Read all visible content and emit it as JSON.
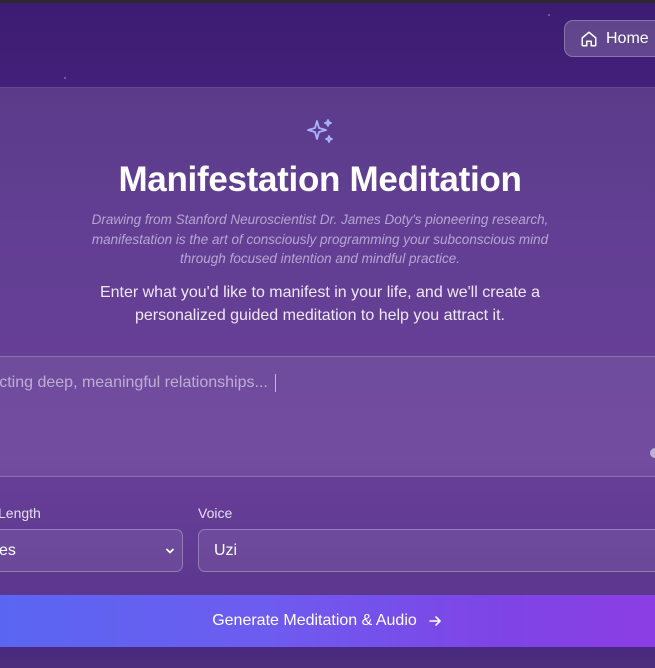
{
  "header": {
    "home_label": "Home",
    "home_icon": "home-icon"
  },
  "main": {
    "icon": "sparkles-icon",
    "title": "Manifestation Meditation",
    "quote": "Drawing from Stanford Neuroscientist Dr. James Doty's pioneering research, manifestation is the art of consciously programming your subconscious mind through focused intention and mindful practice.",
    "intro": "Enter what you'd like to manifest in your life, and we'll create a personalized guided meditation to help you attract it."
  },
  "form": {
    "intention_placeholder": "racting deep, meaningful relationships...",
    "length_label": "Length",
    "length_value": "es",
    "voice_label": "Voice",
    "voice_value": "Uzi",
    "submit_label": "Generate Meditation & Audio"
  },
  "colors": {
    "background": "#4f2786",
    "button_start": "#5a66f2",
    "button_end": "#8b3ee3",
    "accent_icon": "#a8b4ff"
  }
}
